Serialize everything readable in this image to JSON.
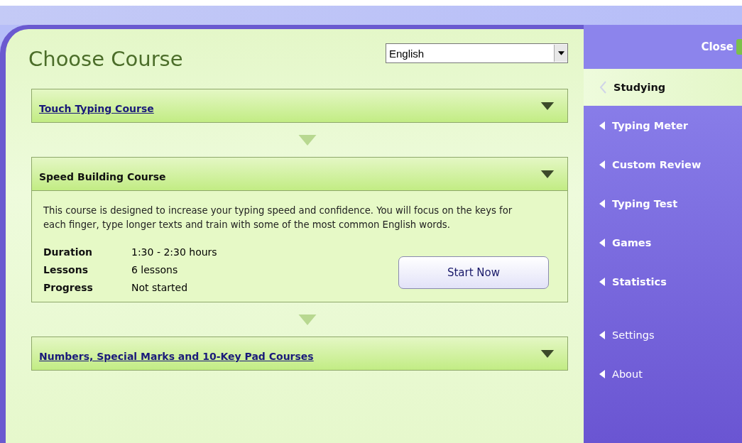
{
  "header": {
    "title": "Choose Course",
    "language": {
      "value": "English"
    }
  },
  "courses": [
    {
      "title": "Touch Typing Course",
      "expanded": false
    },
    {
      "title": "Speed Building Course",
      "expanded": true,
      "description": "This course is designed to increase your typing speed and confidence. You will focus on the keys for each finger, type longer texts and train with some of the most common English words.",
      "details": [
        {
          "label": "Duration",
          "value": "1:30 - 2:30 hours"
        },
        {
          "label": "Lessons",
          "value": "6 lessons"
        },
        {
          "label": "Progress",
          "value": "Not started"
        }
      ],
      "button": "Start Now"
    },
    {
      "title": "Numbers, Special Marks and 10-Key Pad Courses",
      "expanded": false
    }
  ],
  "sidebar": {
    "close": "Close",
    "items": [
      {
        "label": "Studying",
        "selected": true,
        "kind": "main"
      },
      {
        "label": "Typing Meter",
        "selected": false,
        "kind": "main"
      },
      {
        "label": "Custom Review",
        "selected": false,
        "kind": "main"
      },
      {
        "label": "Typing Test",
        "selected": false,
        "kind": "main"
      },
      {
        "label": "Games",
        "selected": false,
        "kind": "main"
      },
      {
        "label": "Statistics",
        "selected": false,
        "kind": "main"
      },
      {
        "label": "Settings",
        "selected": false,
        "kind": "extra"
      },
      {
        "label": "About",
        "selected": false,
        "kind": "extra"
      }
    ]
  }
}
